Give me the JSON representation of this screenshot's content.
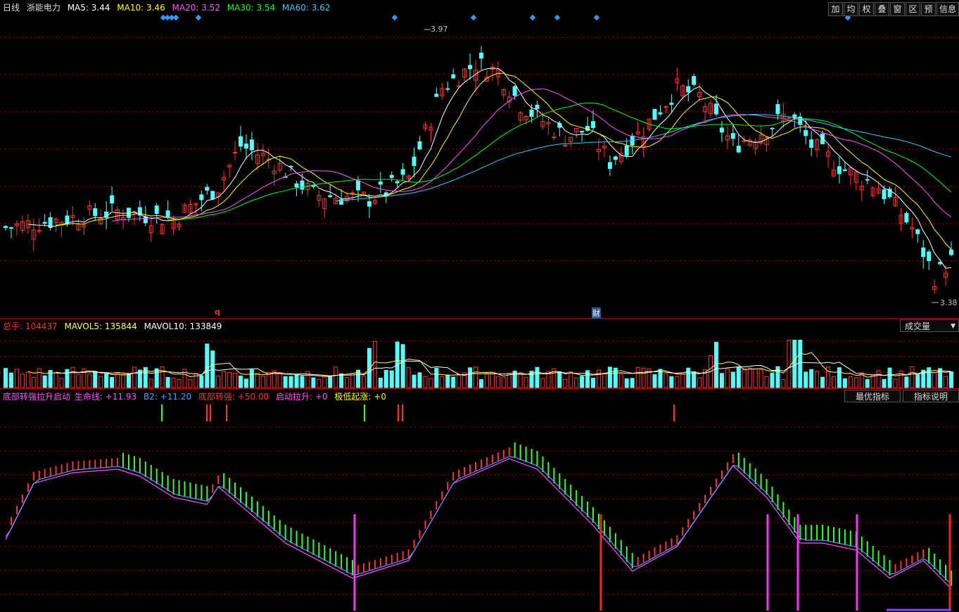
{
  "header": {
    "period": "日线",
    "stock": "浙能电力",
    "ma": [
      {
        "label": "MA5: 3.44",
        "color": "#ffffff"
      },
      {
        "label": "MA10: 3.46",
        "color": "#ffff00"
      },
      {
        "label": "MA20: 3.52",
        "color": "#ff55ff"
      },
      {
        "label": "MA30: 3.54",
        "color": "#00ff00"
      },
      {
        "label": "MA60: 3.62",
        "color": "#33ccff"
      }
    ]
  },
  "toolbar": [
    "加",
    "均",
    "权",
    "叠",
    "窗",
    "区",
    "预",
    "信息"
  ],
  "price_axis": {
    "high_label": "3.97",
    "low_label": "3.38",
    "high": 3.97,
    "low": 3.38
  },
  "markers": {
    "q": "q",
    "cai": "财"
  },
  "volume_panel": {
    "items": [
      {
        "label": "总手: 104437",
        "color": "#ff3333"
      },
      {
        "label": "MAVOL5: 135844",
        "color": "#ffff66"
      },
      {
        "label": "MAVOL10: 133849",
        "color": "#ffffff"
      }
    ],
    "select": "成交量",
    "select_arrow": "▼"
  },
  "indicator_panel": {
    "items": [
      {
        "label": "底部转强拉升启动",
        "color": "#ff55ff"
      },
      {
        "label": "生命线: +11.93",
        "color": "#ff55ff"
      },
      {
        "label": "B2: +11.20",
        "color": "#5599ff"
      },
      {
        "label": "底部转强: +50.00",
        "color": "#ff3333"
      },
      {
        "label": "启动拉升: +0",
        "color": "#ff55ff"
      },
      {
        "label": "极低起涨: +0",
        "color": "#ffff00"
      }
    ],
    "btn_best": "最优指标",
    "btn_desc": "指标说明"
  },
  "colors": {
    "up": "#ff3333",
    "down": "#54ffff",
    "grid": "#8b0000",
    "volup": "#ff3333",
    "voldown": "#54ffff"
  },
  "chart_data": {
    "type": "candlestick",
    "bars": 170,
    "y_range": [
      3.38,
      3.97
    ],
    "notes": "daily candles with MA lines, volume and custom indicator"
  }
}
